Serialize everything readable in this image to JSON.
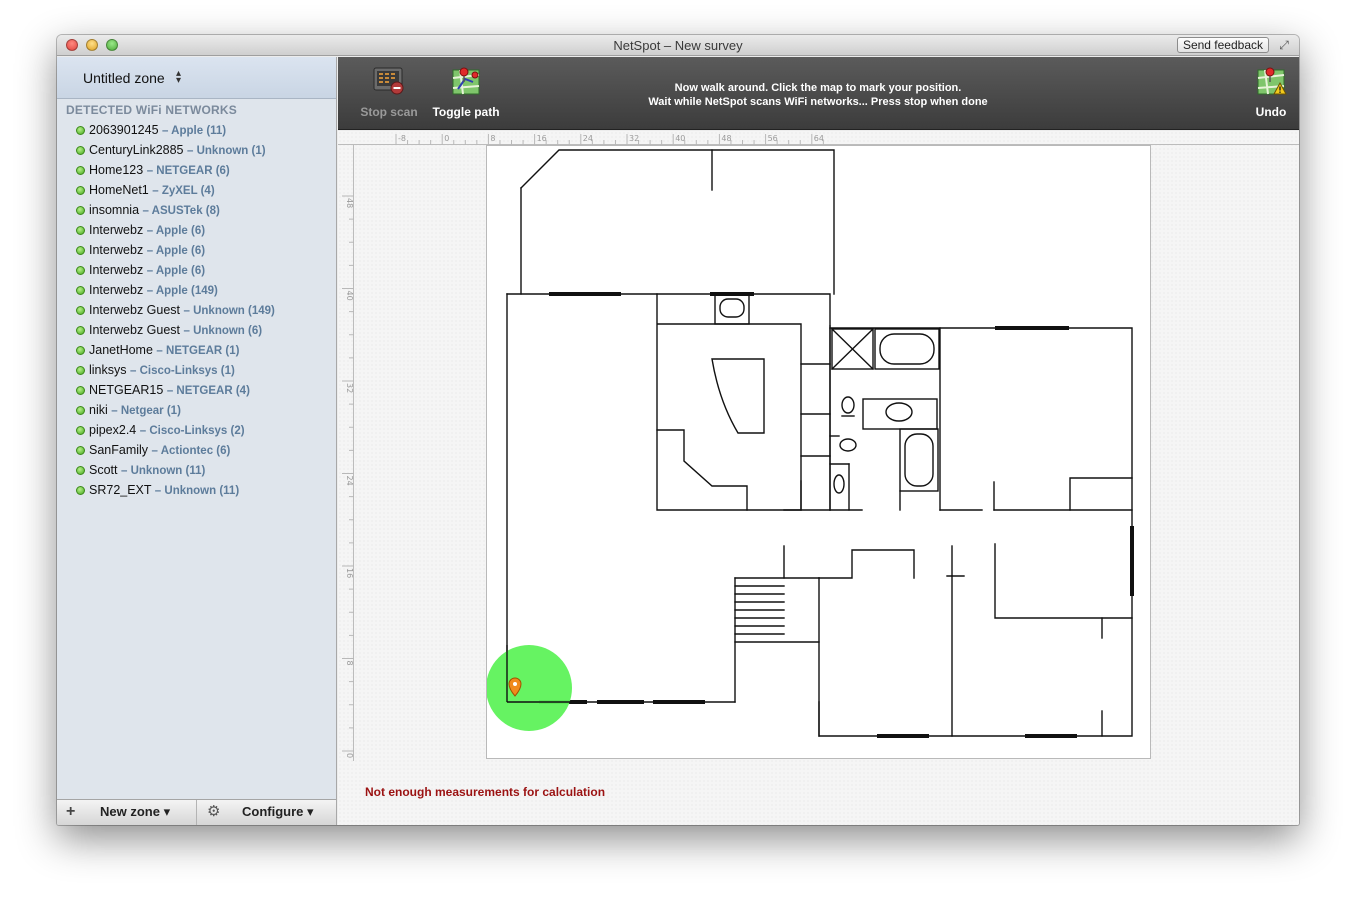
{
  "window": {
    "title": "NetSpot – New survey",
    "feedback_label": "Send feedback"
  },
  "sidebar": {
    "zone_label": "Untitled zone",
    "networks_header": "DETECTED WiFi NETWORKS",
    "networks": [
      {
        "ssid": "2063901245",
        "vendor": "– Apple (11)"
      },
      {
        "ssid": "CenturyLink2885",
        "vendor": "– Unknown (1)"
      },
      {
        "ssid": "Home123",
        "vendor": "– NETGEAR (6)"
      },
      {
        "ssid": "HomeNet1",
        "vendor": "– ZyXEL (4)"
      },
      {
        "ssid": "insomnia",
        "vendor": "– ASUSTek (8)"
      },
      {
        "ssid": "Interwebz",
        "vendor": "– Apple (6)"
      },
      {
        "ssid": "Interwebz",
        "vendor": "– Apple (6)"
      },
      {
        "ssid": "Interwebz",
        "vendor": "– Apple (6)"
      },
      {
        "ssid": "Interwebz",
        "vendor": "– Apple (149)"
      },
      {
        "ssid": "Interwebz Guest",
        "vendor": "– Unknown (149)"
      },
      {
        "ssid": "Interwebz Guest",
        "vendor": "– Unknown (6)"
      },
      {
        "ssid": "JanetHome",
        "vendor": "– NETGEAR (1)"
      },
      {
        "ssid": "linksys",
        "vendor": "– Cisco-Linksys (1)"
      },
      {
        "ssid": "NETGEAR15",
        "vendor": "– NETGEAR (4)"
      },
      {
        "ssid": "niki",
        "vendor": "– Netgear (1)"
      },
      {
        "ssid": "pipex2.4",
        "vendor": "– Cisco-Linksys (2)"
      },
      {
        "ssid": "SanFamily",
        "vendor": "– Actiontec (6)"
      },
      {
        "ssid": "Scott",
        "vendor": "– Unknown (11)"
      },
      {
        "ssid": "SR72_EXT",
        "vendor": "– Unknown (11)"
      }
    ],
    "footer": {
      "new_zone_label": "New zone ▾",
      "configure_label": "Configure ▾"
    }
  },
  "toolbar": {
    "stop_scan_label": "Stop scan",
    "toggle_path_label": "Toggle path",
    "undo_label": "Undo",
    "instruction_line1": "Now walk around. Click the map to mark your position.",
    "instruction_line2": "Wait while NetSpot scans WiFi networks... Press stop when done"
  },
  "rulers": {
    "top_ticks": [
      "-8",
      "0",
      "8",
      "16",
      "24",
      "32",
      "40",
      "48",
      "56",
      "64"
    ],
    "left_ticks": [
      "48",
      "40",
      "32",
      "24",
      "16",
      "8",
      "0"
    ]
  },
  "status_message": "Not enough measurements for calculation",
  "icons": {
    "stop_scan": "stop-scan-icon",
    "toggle_path": "toggle-path-icon",
    "undo": "undo-icon",
    "new_zone": "plus-icon",
    "configure": "gear-icon",
    "zone_selector": "updown-arrows-icon",
    "position_marker": "map-pin-icon"
  },
  "colors": {
    "signal_coverage": "#5ef25a",
    "network_dot": "#46a81e",
    "status_message": "#9b1212",
    "vendor_text": "#5d7c9b",
    "marker": "#f08a1c"
  }
}
